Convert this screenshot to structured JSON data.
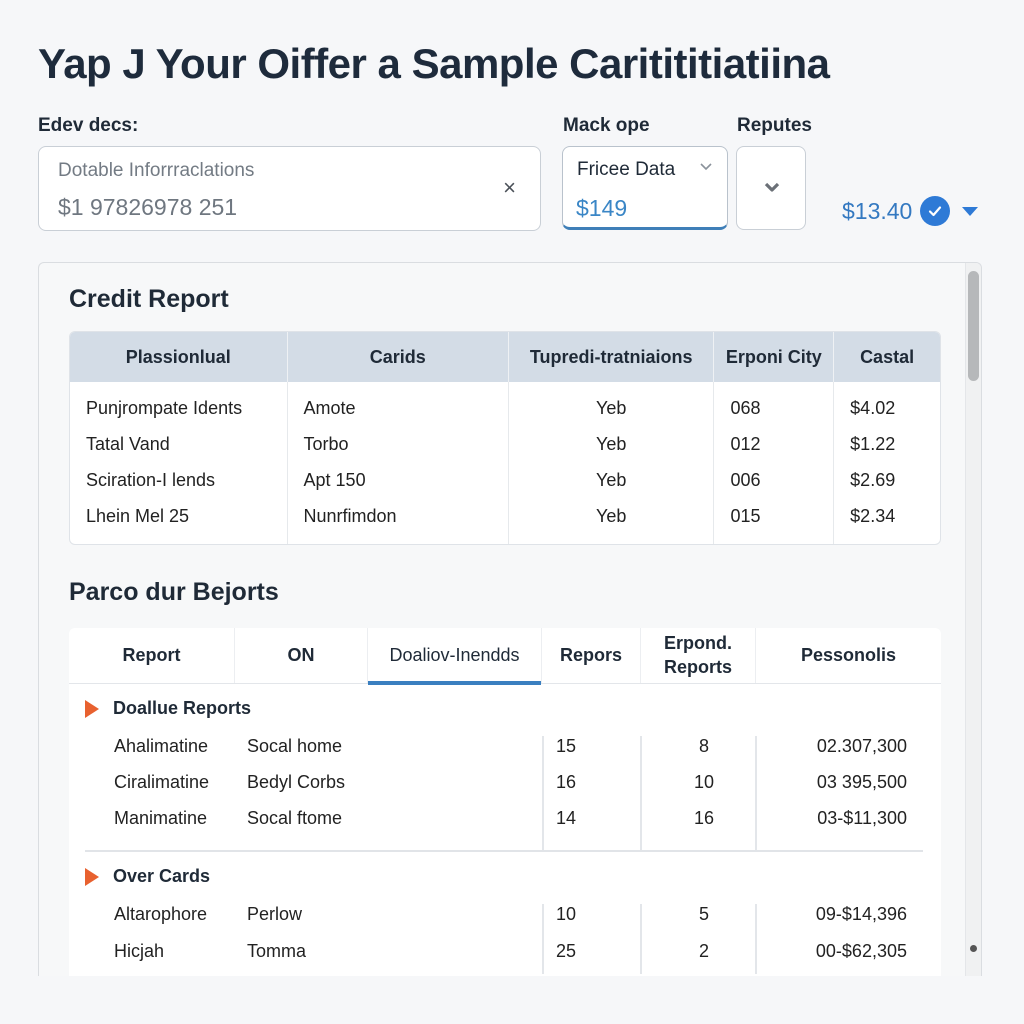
{
  "page": {
    "title": "Yap J Your Oiffer a Sample Caritititiatiina"
  },
  "filters": {
    "field1": {
      "label": "Edev decs:",
      "placeholder": "Dotable Inforrraclations",
      "value": "$1 97826978 251",
      "clear_icon": "×"
    },
    "field2": {
      "label": "Mack ope",
      "selected": "Fricee Data",
      "value": "$149"
    },
    "field3": {
      "label": "Reputes"
    },
    "price": {
      "amount": "$13.40",
      "status": "verified"
    }
  },
  "credit_report": {
    "title": "Credit Report",
    "columns": [
      "Plassionlual",
      "Carids",
      "Tupredi-tratniaions",
      "Erponi City",
      "Castal"
    ],
    "rows": [
      [
        "Punjrompate Idents",
        "Amote",
        "Yeb",
        "068",
        "$4.02"
      ],
      [
        "Tatal Vand",
        "Torbo",
        "Yeb",
        "012",
        "$1.22"
      ],
      [
        "Sciration-I lends",
        "Apt 150",
        "Yeb",
        "006",
        "$2.69"
      ],
      [
        "Lhein Mel 25",
        "Nunrfimdon",
        "Yeb",
        "015",
        "$2.34"
      ]
    ]
  },
  "reports": {
    "title": "Parco dur Bejorts",
    "tabs": [
      {
        "label": "Report",
        "active": false
      },
      {
        "label": "ON",
        "active": false
      },
      {
        "label": "Doaliov-Inendds",
        "active": true
      },
      {
        "label": "Repors",
        "active": false
      },
      {
        "label": "Erpond. Reports",
        "active": false
      },
      {
        "label": "Pessonolis",
        "active": false
      }
    ],
    "groups": [
      {
        "name": "Doallue Reports",
        "rows": [
          [
            "Ahalimatine",
            "Socal home",
            "15",
            "8",
            "02.307,300"
          ],
          [
            "Ciralimatine",
            "Bedyl Corbs",
            "16",
            "10",
            "03 395,500"
          ],
          [
            "Manimatine",
            "Socal ftome",
            "14",
            "16",
            "03-$11,300"
          ]
        ]
      },
      {
        "name": "Over Cards",
        "rows": [
          [
            "Altarophore",
            "Perlow",
            "10",
            "5",
            "09-$14,396"
          ],
          [
            "Hicjah",
            "Tomma",
            "25",
            "2",
            "00-$62,305"
          ]
        ]
      }
    ]
  }
}
